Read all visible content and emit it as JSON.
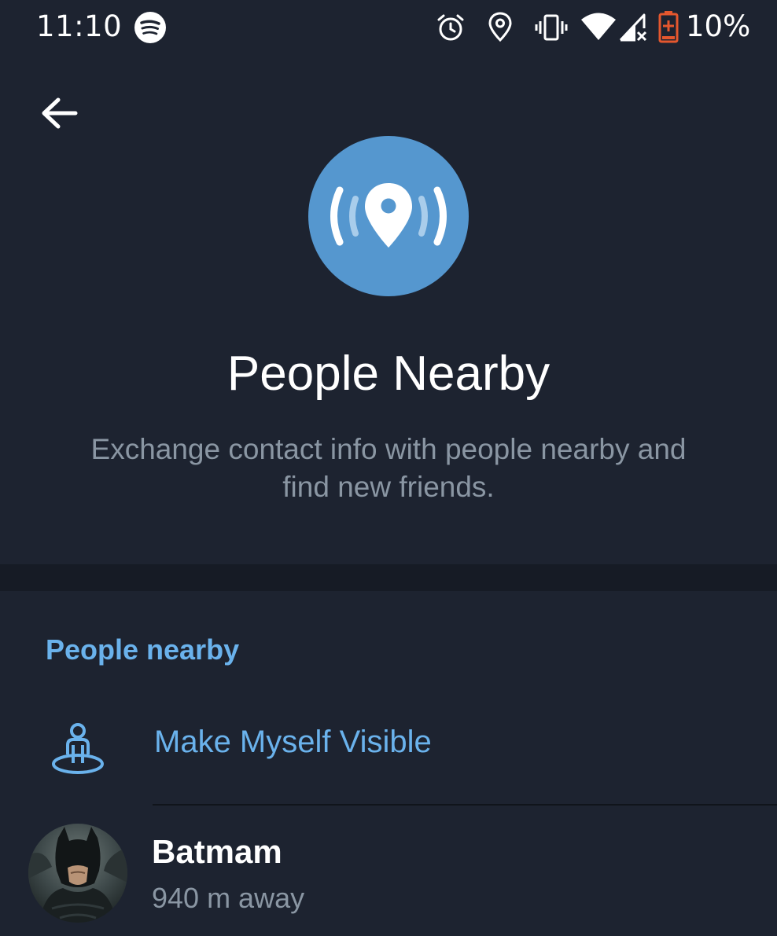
{
  "status_bar": {
    "time": "11:10",
    "battery_percent": "10%",
    "icons": [
      "spotify-icon",
      "alarm-icon",
      "location-icon",
      "vibrate-icon",
      "wifi-icon",
      "signal-icon",
      "battery-icon"
    ],
    "battery_color": "#e4572e"
  },
  "toolbar": {
    "back_icon": "arrow-left-icon"
  },
  "hero": {
    "icon": "location-broadcast-icon",
    "icon_bg_color": "#5597cf",
    "title": "People Nearby",
    "subtitle": "Exchange contact info with people nearby and find new friends."
  },
  "section": {
    "header": "People nearby",
    "accent_color": "#6ab2ec"
  },
  "visibility_row": {
    "icon": "person-visible-icon",
    "label": "Make Myself Visible"
  },
  "users": [
    {
      "name": "Batmam",
      "distance": "940 m away",
      "avatar": "batman-avatar"
    }
  ],
  "colors": {
    "background": "#1d2330",
    "divider": "#161b25",
    "secondary_text": "#8a96a3"
  }
}
